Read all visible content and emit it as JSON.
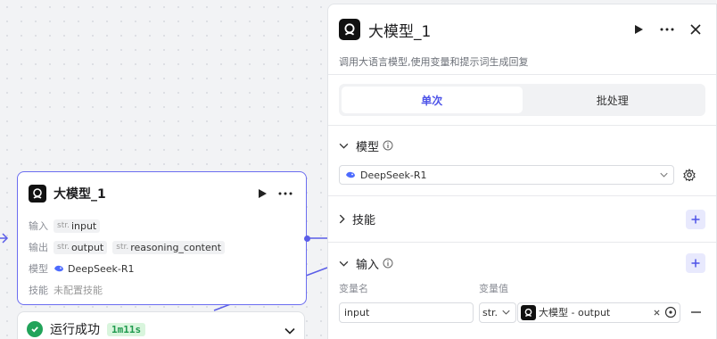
{
  "node": {
    "title": "大模型_1",
    "rows": {
      "input_label": "输入",
      "input_type": "str.",
      "input_name": "input",
      "output_label": "输出",
      "output_type": "str.",
      "output_name": "output",
      "output_type2": "str.",
      "output_name2": "reasoning_content",
      "model_label": "模型",
      "model_name": "DeepSeek-R1",
      "skill_label": "技能",
      "skill_value": "未配置技能"
    }
  },
  "run_status": {
    "label": "运行成功",
    "time": "1m11s"
  },
  "panel": {
    "title": "大模型_1",
    "description": "调用大语言模型,使用变量和提示词生成回复",
    "tabs": [
      {
        "label": "单次",
        "active": true
      },
      {
        "label": "批处理",
        "active": false
      }
    ],
    "model_section": {
      "title": "模型",
      "selected_model": "DeepSeek-R1"
    },
    "skills_section": {
      "title": "技能"
    },
    "input_section": {
      "title": "输入",
      "col_name": "变量名",
      "col_value": "变量值",
      "var_name": "input",
      "var_type": "str.",
      "ref_value": "大模型 - output"
    }
  },
  "colors": {
    "accent": "#4d53e8",
    "node_border": "#6b6df0",
    "success": "#22a35a"
  }
}
